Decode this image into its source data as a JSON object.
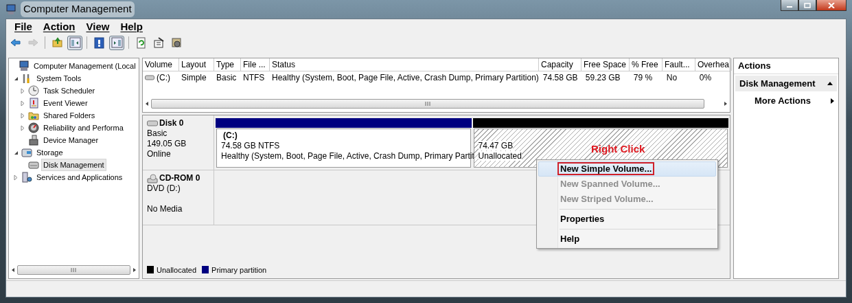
{
  "window": {
    "title": "Computer Management"
  },
  "menu": [
    "File",
    "Action",
    "View",
    "Help"
  ],
  "toolbar": [
    {
      "kind": "back",
      "disabled": false,
      "pressed": false
    },
    {
      "kind": "forward",
      "disabled": true,
      "pressed": false
    },
    {
      "kind": "sep"
    },
    {
      "kind": "up",
      "disabled": false,
      "pressed": false
    },
    {
      "kind": "pane",
      "disabled": false,
      "pressed": true
    },
    {
      "kind": "sep"
    },
    {
      "kind": "help",
      "disabled": false,
      "pressed": false
    },
    {
      "kind": "pane2",
      "disabled": false,
      "pressed": true
    },
    {
      "kind": "sep"
    },
    {
      "kind": "refresh",
      "disabled": false,
      "pressed": false
    },
    {
      "kind": "props",
      "disabled": false,
      "pressed": false
    },
    {
      "kind": "settings",
      "disabled": false,
      "pressed": false
    }
  ],
  "tree": [
    {
      "label": "Computer Management (Local",
      "kind": "computer",
      "has_children": false,
      "selected": false,
      "children": [
        {
          "label": "System Tools",
          "kind": "tools",
          "has_children": true,
          "expanded": true,
          "selected": false,
          "children": [
            {
              "label": "Task Scheduler",
              "kind": "clock",
              "has_children": true,
              "expanded": false,
              "selected": false
            },
            {
              "label": "Event Viewer",
              "kind": "log",
              "has_children": true,
              "expanded": false,
              "selected": false
            },
            {
              "label": "Shared Folders",
              "kind": "folder",
              "has_children": true,
              "expanded": false,
              "selected": false
            },
            {
              "label": "Reliability and Performa",
              "kind": "gauge",
              "has_children": true,
              "expanded": false,
              "selected": false
            },
            {
              "label": "Device Manager",
              "kind": "device",
              "has_children": false,
              "selected": false
            }
          ]
        },
        {
          "label": "Storage",
          "kind": "storage",
          "has_children": true,
          "expanded": true,
          "selected": false,
          "children": [
            {
              "label": "Disk Management",
              "kind": "disk",
              "has_children": false,
              "selected": true
            }
          ]
        },
        {
          "label": "Services and Applications",
          "kind": "services",
          "has_children": true,
          "expanded": false,
          "selected": false
        }
      ]
    }
  ],
  "volume_table": {
    "columns": [
      "Volume",
      "Layout",
      "Type",
      "File ...",
      "Status",
      "Capacity",
      "Free Space",
      "% Free",
      "Fault...",
      "Overhea"
    ],
    "rows": [
      [
        "(C:)",
        "Simple",
        "Basic",
        "NTFS",
        "Healthy (System, Boot, Page File, Active, Crash Dump, Primary Partition)",
        "74.58 GB",
        "59.23 GB",
        "79 %",
        "No",
        "0%"
      ]
    ]
  },
  "disks": [
    {
      "name": "Disk 0",
      "kind": "disk",
      "lines": [
        "Basic",
        "149.05 GB",
        "Online"
      ],
      "partitions": [
        {
          "kind": "primary",
          "color": "#000080",
          "name": "(C:)",
          "lines": [
            "74.58 GB NTFS",
            "Healthy (System, Boot, Page File, Active, Crash Dump, Primary Partit"
          ]
        },
        {
          "kind": "unallocated",
          "color": "#000000",
          "lines": [
            "74.47 GB",
            "Unallocated"
          ]
        }
      ]
    },
    {
      "name": "CD-ROM 0",
      "kind": "cdrom",
      "lines": [
        "DVD (D:)",
        "No Media"
      ]
    }
  ],
  "annotation": "Right Click",
  "context_menu": [
    {
      "label": "New Simple Volume...",
      "disabled": false,
      "selected": true,
      "outlined": true,
      "separator_before": false
    },
    {
      "label": "New Spanned Volume...",
      "disabled": true,
      "selected": false,
      "outlined": false,
      "separator_before": false
    },
    {
      "label": "New Striped Volume...",
      "disabled": true,
      "selected": false,
      "outlined": false,
      "separator_before": false
    },
    {
      "label": "Properties",
      "disabled": false,
      "selected": false,
      "outlined": false,
      "separator_before": true
    },
    {
      "label": "Help",
      "disabled": false,
      "selected": false,
      "outlined": false,
      "separator_before": true
    }
  ],
  "legend": [
    {
      "label": "Unallocated",
      "color": "#000000"
    },
    {
      "label": "Primary partition",
      "color": "#000080"
    }
  ],
  "actions": {
    "title": "Actions",
    "section": {
      "label": "Disk Management",
      "expanded": true
    },
    "items": [
      {
        "label": "More Actions",
        "submenu": true
      }
    ]
  }
}
